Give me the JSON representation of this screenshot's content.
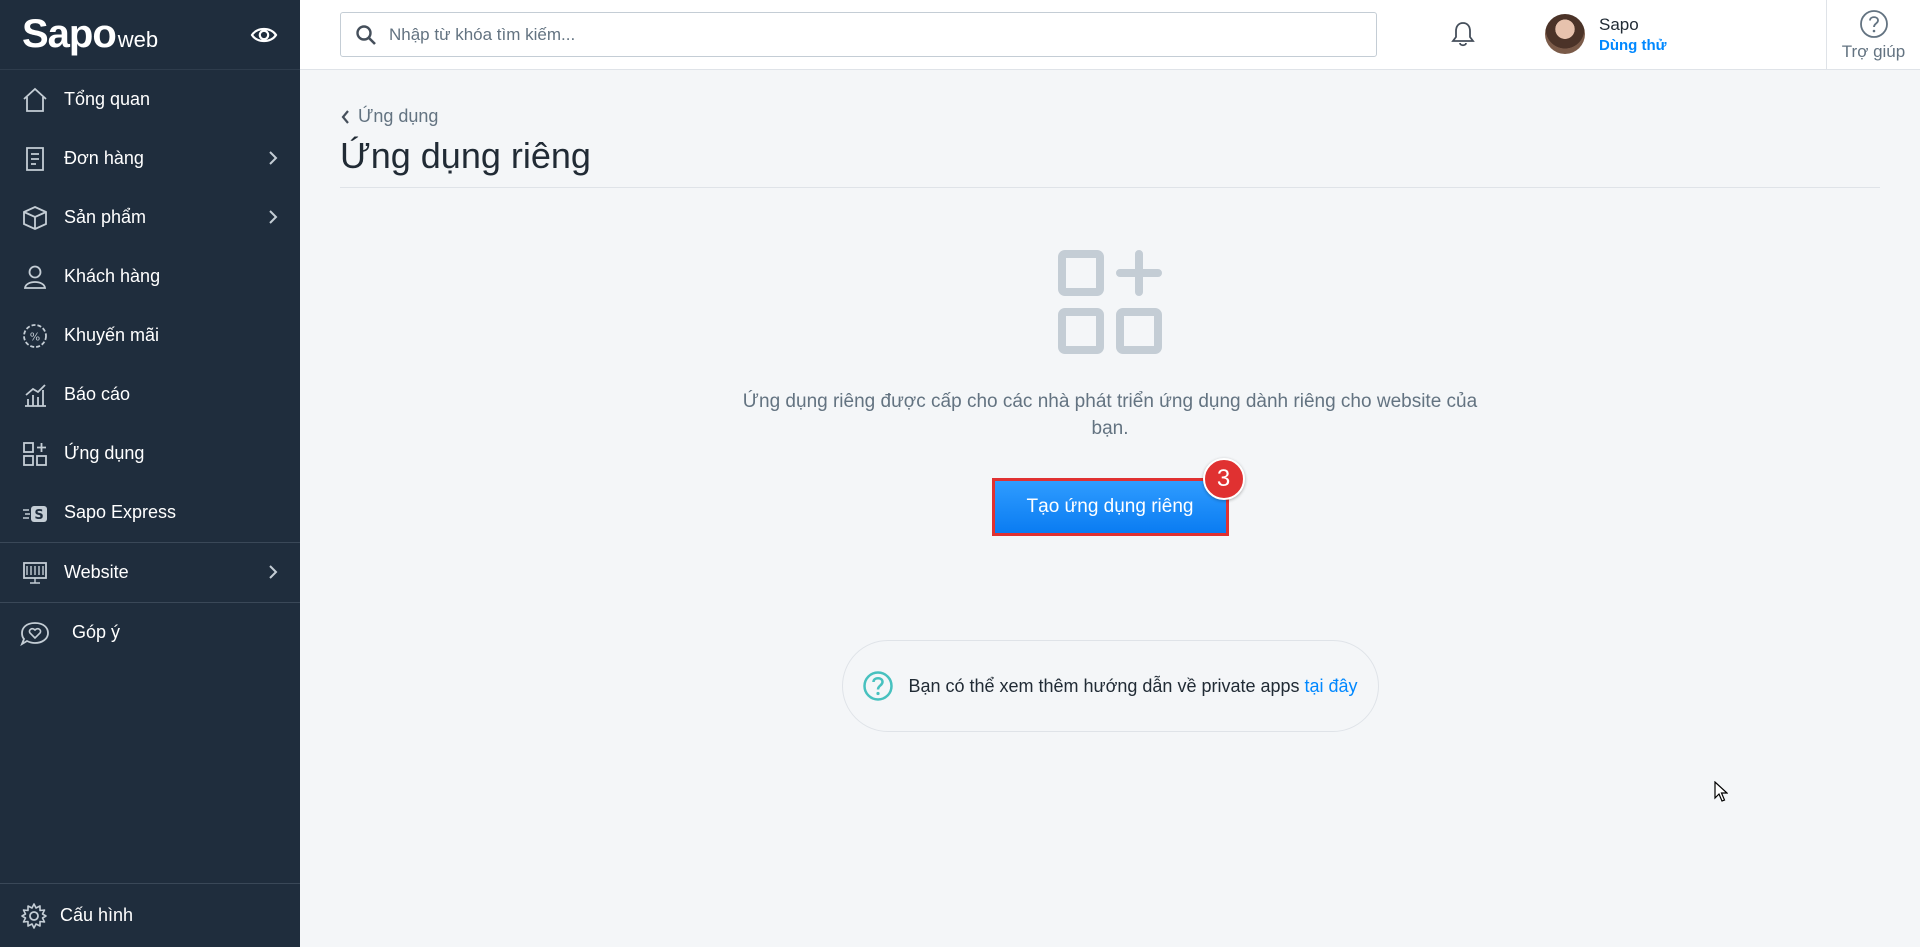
{
  "brand": {
    "logo": "Sapo",
    "logo_sub": "web"
  },
  "sidebar": {
    "items": [
      {
        "label": "Tổng quan",
        "icon": "home-icon"
      },
      {
        "label": "Đơn hàng",
        "icon": "order-icon"
      },
      {
        "label": "Sản phẩm",
        "icon": "box-icon"
      },
      {
        "label": "Khách hàng",
        "icon": "user-icon"
      },
      {
        "label": "Khuyến mãi",
        "icon": "percent-icon"
      },
      {
        "label": "Báo cáo",
        "icon": "chart-icon"
      },
      {
        "label": "Ứng dụng",
        "icon": "apps-icon"
      },
      {
        "label": "Sapo Express",
        "icon": "express-icon"
      },
      {
        "label": "Website",
        "icon": "monitor-icon"
      },
      {
        "label": "Góp ý",
        "icon": "heart-chat-icon"
      }
    ],
    "settings_label": "Cấu hình"
  },
  "topbar": {
    "search_placeholder": "Nhập từ khóa tìm kiếm...",
    "user_name": "Sapo",
    "user_plan": "Dùng thử",
    "help_label": "Trợ giúp"
  },
  "page": {
    "breadcrumb": "Ứng dụng",
    "title": "Ứng dụng riêng",
    "empty_description": "Ứng dụng riêng được cấp cho các nhà phát triển ứng dụng dành riêng cho website của bạn.",
    "cta_label": "Tạo ứng dụng riêng",
    "step_number": "3",
    "hint_text": "Bạn có thể xem thêm hướng dẫn về private apps",
    "hint_link": "tại đây"
  },
  "colors": {
    "sidebar": "#1f2d3d",
    "accent": "#0088ff",
    "highlight": "#e03131"
  }
}
